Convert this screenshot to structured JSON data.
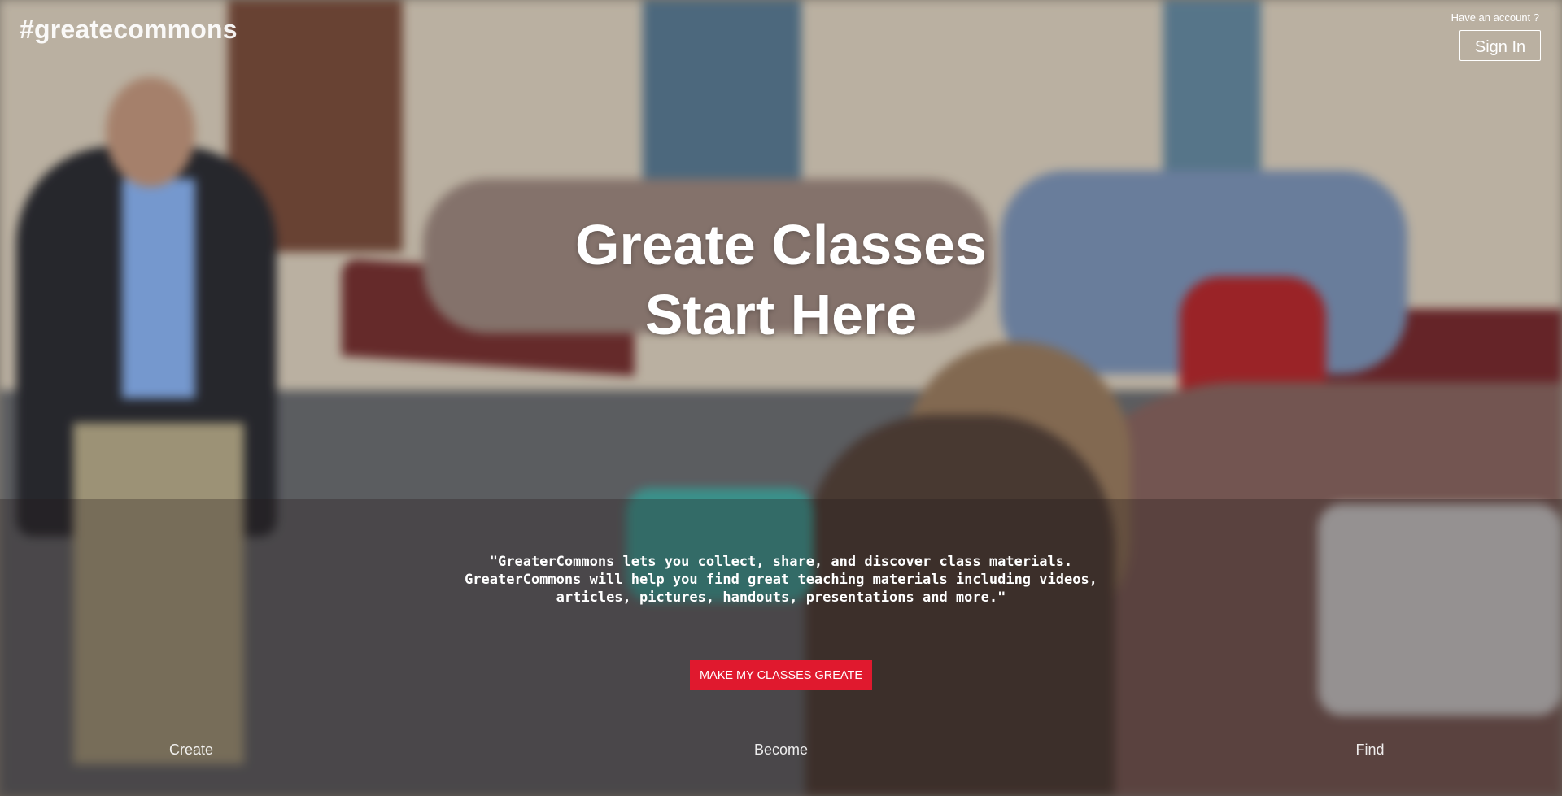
{
  "brand": {
    "logo": "#greatecommons"
  },
  "account": {
    "prompt": "Have an account ?",
    "sign_in_label": "Sign In"
  },
  "hero": {
    "title_line1": "Greate Classes",
    "title_line2": "Start Here",
    "quote_line1": "\"GreaterCommons lets you collect, share, and discover class materials.",
    "quote_line2": "GreaterCommons will help you find great teaching materials including videos,",
    "quote_line3": "articles, pictures, handouts, presentations and more.\"",
    "cta_label": "MAKE MY CLASSES GREATE"
  },
  "bottom_nav": {
    "items": [
      {
        "label": "Create"
      },
      {
        "label": "Become"
      },
      {
        "label": "Find"
      }
    ]
  },
  "colors": {
    "accent": "#e0192e",
    "text": "#ffffff"
  }
}
